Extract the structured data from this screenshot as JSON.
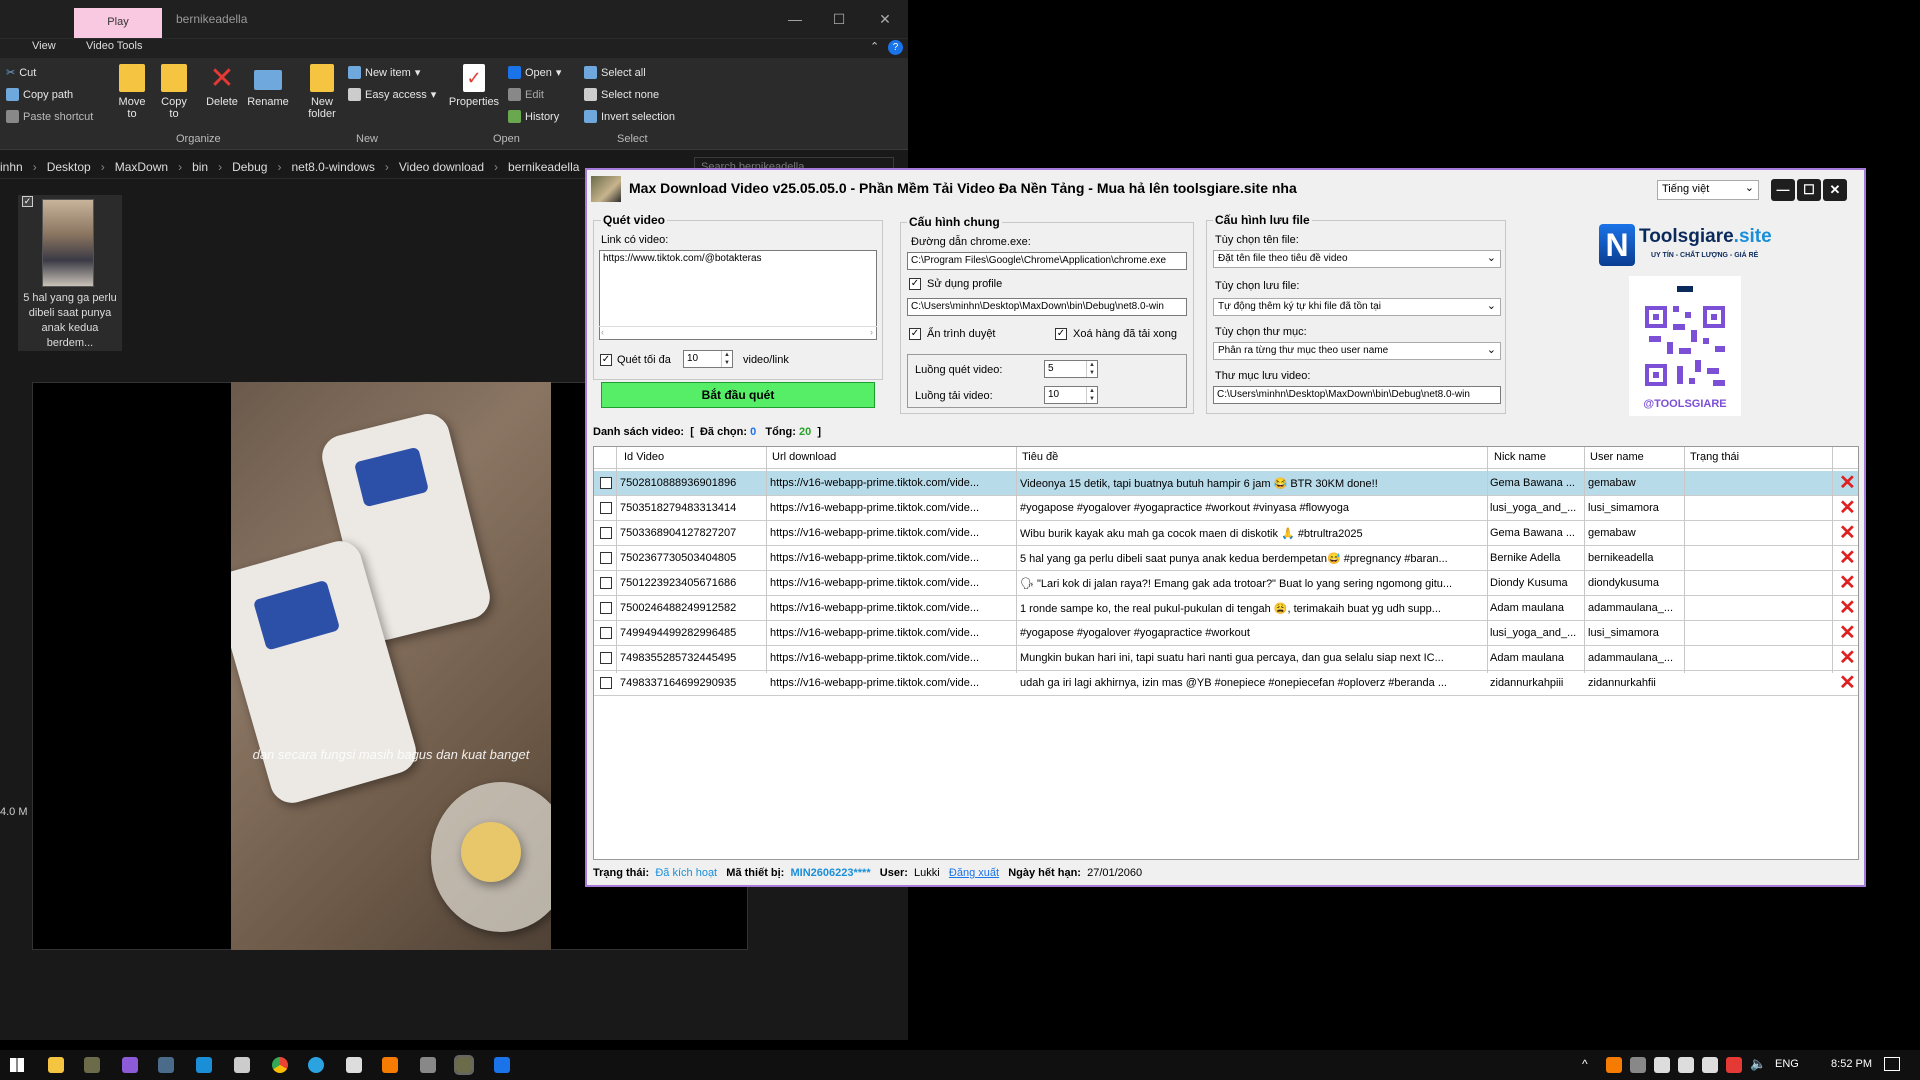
{
  "explorer": {
    "play_tab": "Play",
    "title": "bernikeadella",
    "tabs": [
      "View",
      "Video Tools"
    ],
    "ribbon": {
      "cut": "Cut",
      "copy_path": "Copy path",
      "paste_shortcut": "Paste shortcut",
      "move_to": "Move to",
      "copy_to": "Copy to",
      "delete": "Delete",
      "rename": "Rename",
      "new_folder": "New folder",
      "new_item": "New item",
      "easy_access": "Easy access",
      "properties": "Properties",
      "open": "Open",
      "edit": "Edit",
      "history": "History",
      "select_all": "Select all",
      "select_none": "Select none",
      "invert_selection": "Invert selection",
      "groups": [
        "Organize",
        "New",
        "Open",
        "Select"
      ]
    },
    "breadcrumb": [
      "inhn",
      "Desktop",
      "MaxDown",
      "bin",
      "Debug",
      "net8.0-windows",
      "Video download",
      "bernikeadella"
    ],
    "search_placeholder": "Search bernikeadella",
    "file": {
      "name": "5 hal yang ga perlu dibeli saat punya anak kedua berdem..."
    },
    "video_caption": "dan secara fungsi masih bagus dan kuat banget",
    "size_label": "4.0 M"
  },
  "app": {
    "title": "Max Download Video v25.05.05.0 -  Phần Mềm Tải Video Đa Nền Tảng - Mua hả lên toolsgiare.site nha",
    "language": "Tiếng việt",
    "scan": {
      "group": "Quét video",
      "link_label": "Link có video:",
      "link_value": "https://www.tiktok.com/@botakteras",
      "max_label": "Quét tối đa",
      "max_value": "10",
      "unit": "video/link",
      "start_button": "Bắt đầu quét"
    },
    "general": {
      "group": "Cấu hình chung",
      "chrome_label": "Đường dẫn chrome.exe:",
      "chrome_value": "C:\\Program Files\\Google\\Chrome\\Application\\chrome.exe",
      "use_profile": "Sử dụng profile",
      "profile_value": "C:\\Users\\minhn\\Desktop\\MaxDown\\bin\\Debug\\net8.0-win",
      "hide_process": "Ẩn trình duyệt",
      "remove_done": "Xoá hàng đã tải xong",
      "scan_threads_label": "Luồng quét video:",
      "scan_threads": "5",
      "download_threads_label": "Luồng tải video:",
      "download_threads": "10"
    },
    "save": {
      "group": "Cấu hình lưu file",
      "filename_label": "Tùy chọn tên file:",
      "filename_value": "Đặt tên file theo tiêu đề video",
      "saveopt_label": "Tùy chọn lưu file:",
      "saveopt_value": "Tự động thêm ký tự khi file đã tồn tại",
      "folderopt_label": "Tùy chọn thư mục:",
      "folderopt_value": "Phân ra từng thư mục theo user name",
      "folder_label": "Thư mục lưu video:",
      "folder_value": "C:\\Users\\minhn\\Desktop\\MaxDown\\bin\\Debug\\net8.0-win"
    },
    "brand": {
      "name": "Toolsgiare",
      "suffix": ".site",
      "tagline": "UY TÍN - CHẤT LƯỢNG - GIÁ RẺ",
      "handle": "@TOOLSGIARE"
    },
    "list": {
      "label": "Danh sách video:",
      "selected_label": "Đã chọn:",
      "selected": "0",
      "total_label": "Tổng:",
      "total": "20",
      "columns": [
        "Id Video",
        "Url download",
        "Tiêu đề",
        "Nick name",
        "User name",
        "Trạng thái"
      ],
      "rows": [
        {
          "id": "7502810888936901896",
          "url": "https://v16-webapp-prime.tiktok.com/vide...",
          "title": "Videonya 15 detik, tapi buatnya butuh hampir 6 jam 😂 BTR 30KM done!!",
          "nick": "Gema Bawana ...",
          "user": "gemabaw",
          "status": ""
        },
        {
          "id": "7503518279483313414",
          "url": "https://v16-webapp-prime.tiktok.com/vide...",
          "title": "#yogapose #yogalover #yogapractice #workout #vinyasa #flowyoga",
          "nick": "lusi_yoga_and_...",
          "user": "lusi_simamora",
          "status": ""
        },
        {
          "id": "7503368904127827207",
          "url": "https://v16-webapp-prime.tiktok.com/vide...",
          "title": "Wibu burik kayak aku mah ga cocok maen di diskotik 🙏 #btrultra2025",
          "nick": "Gema Bawana ...",
          "user": "gemabaw",
          "status": ""
        },
        {
          "id": "7502367730503404805",
          "url": "https://v16-webapp-prime.tiktok.com/vide...",
          "title": "5 hal yang ga perlu dibeli saat punya anak kedua berdempetan😅 #pregnancy #baran...",
          "nick": "Bernike Adella",
          "user": "bernikeadella",
          "status": ""
        },
        {
          "id": "7501223923405671686",
          "url": "https://v16-webapp-prime.tiktok.com/vide...",
          "title": "🗣 \"Lari kok di jalan raya?! Emang gak ada trotoar?\" Buat lo yang sering ngomong gitu...",
          "nick": "Diondy Kusuma",
          "user": "diondykusuma",
          "status": ""
        },
        {
          "id": "7500246488249912582",
          "url": "https://v16-webapp-prime.tiktok.com/vide...",
          "title": "1 ronde sampe ko, the real pukul-pukulan di tengah 😩, terimakaih buat yg udh supp...",
          "nick": "Adam maulana",
          "user": "adammaulana_...",
          "status": ""
        },
        {
          "id": "7499494499282996485",
          "url": "https://v16-webapp-prime.tiktok.com/vide...",
          "title": "#yogapose #yogalover #yogapractice #workout",
          "nick": "lusi_yoga_and_...",
          "user": "lusi_simamora",
          "status": ""
        },
        {
          "id": "7498355285732445495",
          "url": "https://v16-webapp-prime.tiktok.com/vide...",
          "title": "Mungkin bukan hari ini, tapi suatu hari nanti gua percaya, dan gua selalu siap next IC...",
          "nick": "Adam maulana",
          "user": "adammaulana_...",
          "status": ""
        },
        {
          "id": "7498337164699290935",
          "url": "https://v16-webapp-prime.tiktok.com/vide...",
          "title": "udah ga iri lagi akhirnya, izin mas @YB #onepiece #onepiecefan #oploverz #beranda ...",
          "nick": "zidannurkahpiii",
          "user": "zidannurkahfii",
          "status": ""
        }
      ]
    },
    "status": {
      "state_label": "Trạng thái:",
      "state": "Đã kích hoạt",
      "device_label": "Mã thiết bị:",
      "device": "MIN2606223****",
      "user_label": "User:",
      "user": "Lukki",
      "logout": "Đăng xuất",
      "expiry_label": "Ngày hết hạn:",
      "expiry": "27/01/2060"
    }
  },
  "taskbar": {
    "lang": "ENG",
    "time": "8:52 PM"
  },
  "colors": {
    "accent": "#a67adb",
    "start": "#55ee66",
    "selected_row": "#b8dbea",
    "active": "#1a8fd8",
    "delete": "#e02020"
  }
}
